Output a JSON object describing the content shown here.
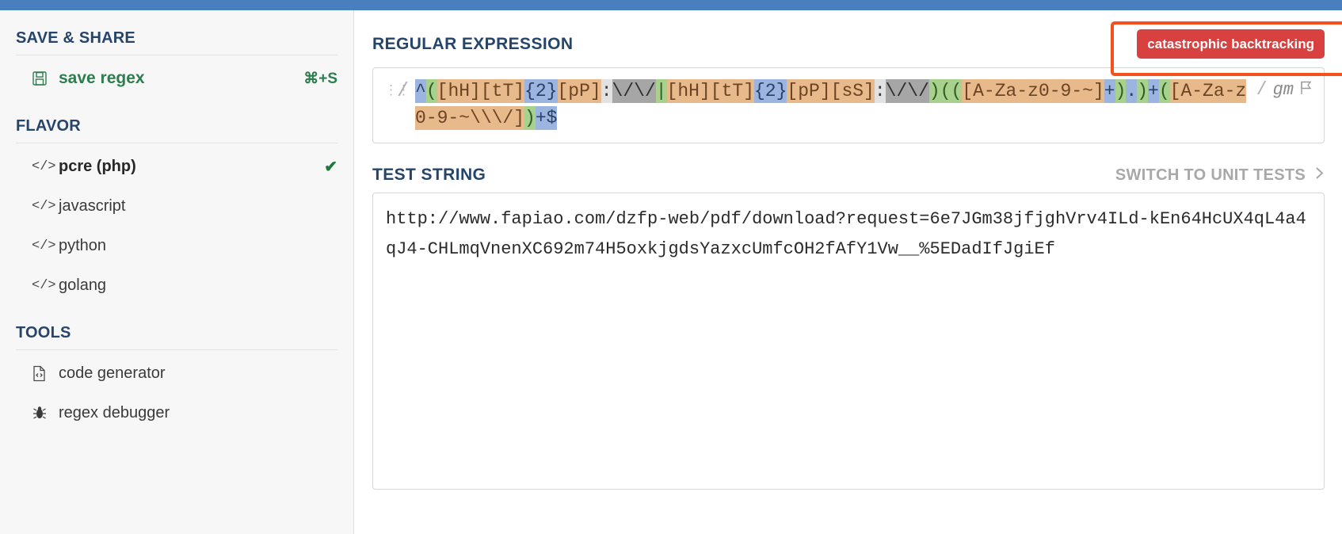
{
  "sidebar": {
    "save_share": {
      "title": "SAVE & SHARE",
      "item": {
        "label": "save regex",
        "shortcut": "⌘+S",
        "icon": "floppy-disk-icon"
      }
    },
    "flavor": {
      "title": "FLAVOR",
      "items": [
        {
          "label": "pcre (php)",
          "icon": "code-brackets-icon",
          "selected": true,
          "check": "✔"
        },
        {
          "label": "javascript",
          "icon": "code-brackets-icon",
          "selected": false
        },
        {
          "label": "python",
          "icon": "code-brackets-icon",
          "selected": false
        },
        {
          "label": "golang",
          "icon": "code-brackets-icon",
          "selected": false
        }
      ]
    },
    "tools": {
      "title": "TOOLS",
      "items": [
        {
          "label": "code generator",
          "icon": "file-code-icon"
        },
        {
          "label": "regex debugger",
          "icon": "bug-icon"
        }
      ]
    }
  },
  "main": {
    "regex_section": {
      "title": "REGULAR EXPRESSION",
      "error_badge": "catastrophic backtracking",
      "error_color": "#d94040",
      "highlight_color": "#f4511e",
      "delimiter": "/",
      "flags": "gm",
      "flag_icon": "flag-icon",
      "grip_icon": "drag-handle-icon",
      "pattern": "^([hH][tT]{2}[pP]:\\/\\/|[hH][tT]{2}[pP][sS]:\\/\\/)(([A-Za-z0-9-~]+).)+([A-Za-z0-9-~\\\\\\/])+$",
      "tokens": [
        {
          "t": "^",
          "k": "anchor"
        },
        {
          "t": "(",
          "k": "group"
        },
        {
          "t": "[hH]",
          "k": "class"
        },
        {
          "t": "[tT]",
          "k": "class"
        },
        {
          "t": "{2}",
          "k": "quant"
        },
        {
          "t": "[pP]",
          "k": "class"
        },
        {
          "t": ":",
          "k": "lit"
        },
        {
          "t": "\\/\\/",
          "k": "esc"
        },
        {
          "t": "|",
          "k": "group"
        },
        {
          "t": "[hH]",
          "k": "class"
        },
        {
          "t": "[tT]",
          "k": "class"
        },
        {
          "t": "{2}",
          "k": "quant"
        },
        {
          "t": "[pP]",
          "k": "class"
        },
        {
          "t": "[sS]",
          "k": "class"
        },
        {
          "t": ":",
          "k": "lit"
        },
        {
          "t": "\\/\\/",
          "k": "esc"
        },
        {
          "t": ")",
          "k": "group"
        },
        {
          "t": "(",
          "k": "group"
        },
        {
          "t": "(",
          "k": "group"
        },
        {
          "t": "[A-Za-z0-9-~]",
          "k": "class"
        },
        {
          "t": "+",
          "k": "quant"
        },
        {
          "t": ")",
          "k": "group"
        },
        {
          "t": ".",
          "k": "dot"
        },
        {
          "t": ")",
          "k": "group"
        },
        {
          "t": "+",
          "k": "quant"
        },
        {
          "t": "(",
          "k": "group"
        },
        {
          "t": "[A-Za-z0-9-~\\\\\\/]",
          "k": "class"
        },
        {
          "t": ")",
          "k": "group"
        },
        {
          "t": "+",
          "k": "quant"
        },
        {
          "t": "$",
          "k": "anchor"
        }
      ]
    },
    "test_section": {
      "title": "TEST STRING",
      "switch_label": "SWITCH TO UNIT TESTS",
      "switch_icon": "chevron-right-icon",
      "content": "http://www.fapiao.com/dzfp-web/pdf/download?request=6e7JGm38jfjghVrv4ILd-kEn64HcUX4qL4a4qJ4-CHLmqVnenXC692m74H5oxkjgdsYazxcUmfcOH2fAfY1Vw__%5EDadIfJgiEf"
    }
  }
}
